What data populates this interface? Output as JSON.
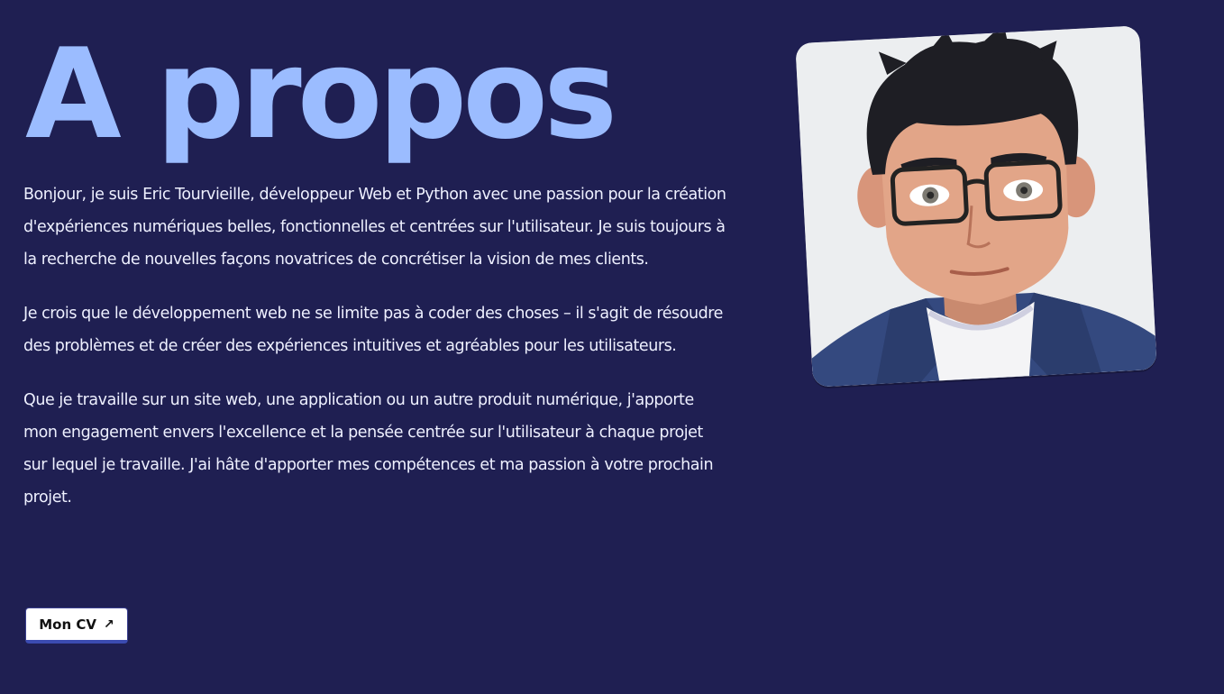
{
  "about": {
    "title": "A propos",
    "paragraphs": [
      "Bonjour, je suis Eric Tourvieille, développeur Web et Python avec une passion pour la création d'expériences numériques belles, fonctionnelles et centrées sur l'utilisateur. Je suis toujours à la recherche de nouvelles façons novatrices de concrétiser la vision de mes clients.",
      "Je crois que le développement web ne se limite pas à coder des choses – il s'agit de résoudre des problèmes et de créer des expériences intuitives et agréables pour les utilisateurs.",
      "Que je travaille sur un site web, une application ou un autre produit numérique, j'apporte mon engagement envers l'excellence et la pensée centrée sur l'utilisateur à chaque projet sur lequel je travaille. J'ai hâte d'apporter mes compétences et ma passion à votre prochain projet."
    ],
    "cv_button_label": "Mon CV",
    "cv_button_icon": "arrow-up-right-icon"
  },
  "colors": {
    "background": "#1f1f52",
    "title": "#9bbcff",
    "text": "#eef0ff",
    "button_bg": "#ffffff",
    "button_accent": "#3b4bb0"
  },
  "avatar": {
    "icon": "cartoon-avatar-portrait"
  }
}
